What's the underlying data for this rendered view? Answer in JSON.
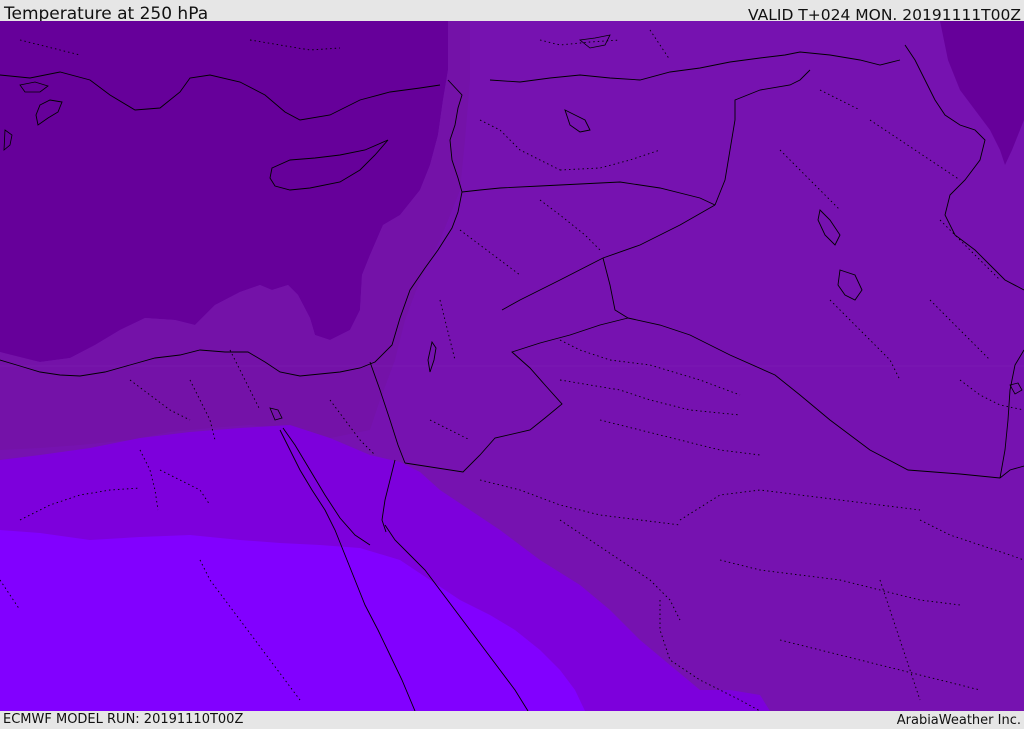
{
  "header": {
    "title": "Temperature at 250 hPa",
    "valid_time": "VALID T+024 MON. 20191111T00Z"
  },
  "footer": {
    "model_run": "ECMWF MODEL RUN: 20191110T00Z",
    "credit": "ArabiaWeather Inc."
  },
  "colors": {
    "band_coldest": "#66009a",
    "band_cold": "#7612b0",
    "band_mid": "#7d00dc",
    "band_warm": "#8200ff",
    "band_main": "#760fb3",
    "border_line": "#000000"
  }
}
